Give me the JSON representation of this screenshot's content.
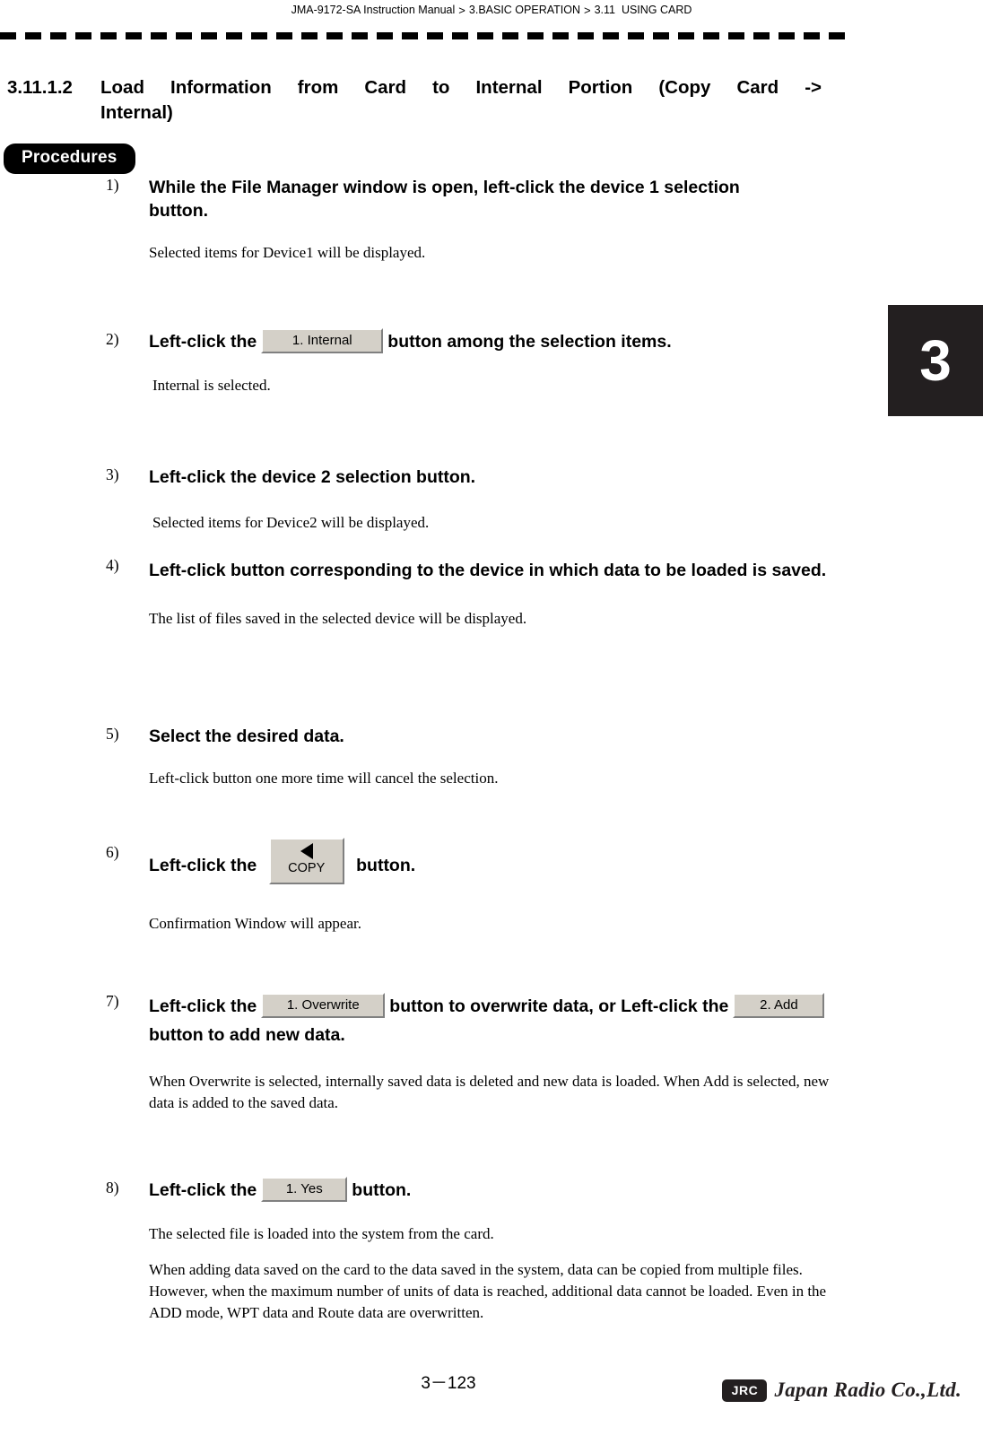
{
  "header": {
    "manual": "JMA-9172-SA Instruction Manual",
    "sep1": ">",
    "chapter": "3.BASIC OPERATION",
    "sep2": ">",
    "section": "3.11  USING CARD"
  },
  "chapter_tab": "3",
  "section": {
    "number": "3.11.1.2",
    "title_line1": "Load Information from Card to Internal Portion (Copy Card ->",
    "title_line2": "Internal)"
  },
  "procedures_label": "Procedures",
  "steps": [
    {
      "no": "1)",
      "title": "While the File Manager window is open, left-click the device 1 selection button.",
      "body": "Selected items for  Device1 will be displayed."
    },
    {
      "no": "2)",
      "title_pre": "Left-click the",
      "button": "1. Internal",
      "title_post": "button among the selection items.",
      "body": "Internal is selected."
    },
    {
      "no": "3)",
      "title": "Left-click the device 2 selection button.",
      "body": "Selected items for  Device2  will be displayed."
    },
    {
      "no": "4)",
      "title": "Left-click button corresponding to the device in which data to be loaded is saved.",
      "body": "The list of files saved in the selected device will be displayed."
    },
    {
      "no": "5)",
      "title": "Select the desired data.",
      "body": "Left-click button one more time will cancel the selection."
    },
    {
      "no": "6)",
      "title_pre": "Left-click the",
      "button": "COPY",
      "title_post": "button.",
      "body": "Confirmation Window will appear."
    },
    {
      "no": "7)",
      "title_pre": "Left-click the",
      "button1": "1. Overwrite",
      "title_mid": "button to overwrite data, or Left-click the",
      "button2": "2. Add",
      "title_post": "button to add new data.",
      "body": "When Overwrite is selected, internally saved data is deleted and new data is loaded. When Add is selected, new data is added to the saved data."
    },
    {
      "no": "8)",
      "title_pre": "Left-click the",
      "button": "1. Yes",
      "title_post": "button.",
      "body": "The selected file is loaded into the system from the card.",
      "body2": "When adding data saved on the card to the data saved in the system, data can be copied from multiple files. However, when the maximum number of units of data is reached, additional data cannot be loaded. Even in the ADD mode, WPT data and Route data are overwritten."
    }
  ],
  "footer": {
    "page": "3－123",
    "logo_badge": "JRC",
    "logo_name": "Japan Radio Co.,Ltd."
  }
}
